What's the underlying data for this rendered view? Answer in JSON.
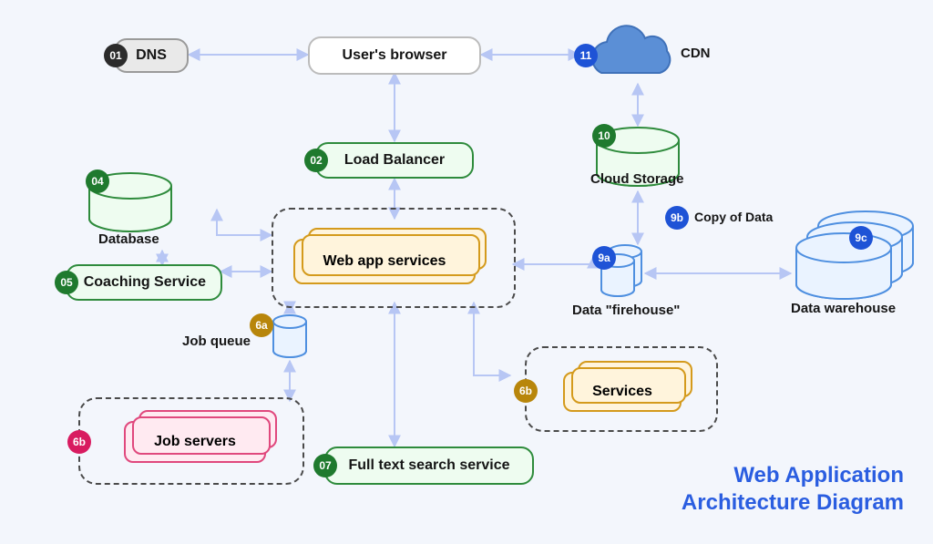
{
  "title_line1": "Web Application",
  "title_line2": "Architecture Diagram",
  "nodes": {
    "dns": {
      "num": "01",
      "label": "DNS"
    },
    "browser": {
      "label": "User's browser"
    },
    "load_balancer": {
      "num": "02",
      "label": "Load Balancer"
    },
    "database": {
      "num": "04",
      "label": "Database"
    },
    "coaching": {
      "num": "05",
      "label": "Coaching Service"
    },
    "web_app": {
      "label": "Web app services"
    },
    "job_queue": {
      "num": "6a",
      "label": "Job queue"
    },
    "job_servers": {
      "num": "6b",
      "label": "Job servers"
    },
    "fulltext": {
      "num": "07",
      "label": "Full text search service"
    },
    "services": {
      "num": "6b",
      "label": "Services"
    },
    "firehouse": {
      "num": "9a",
      "label": "Data \"firehouse\""
    },
    "copy_of_data": {
      "num": "9b",
      "label": "Copy of Data"
    },
    "warehouse": {
      "num": "9c",
      "label": "Data warehouse"
    },
    "cloud_storage": {
      "num": "10",
      "label": "Cloud Storage"
    },
    "cdn": {
      "num": "11",
      "label": "CDN"
    }
  },
  "colors": {
    "bg": "#f3f6fc",
    "arrow": "#b7c6f4",
    "green": "#2e8b3c",
    "gold": "#d49a1c",
    "pink": "#e0487d",
    "blue": "#2a5de0",
    "cloud": "#5b8fd6",
    "cyl_blue": "#4e8fe0"
  }
}
